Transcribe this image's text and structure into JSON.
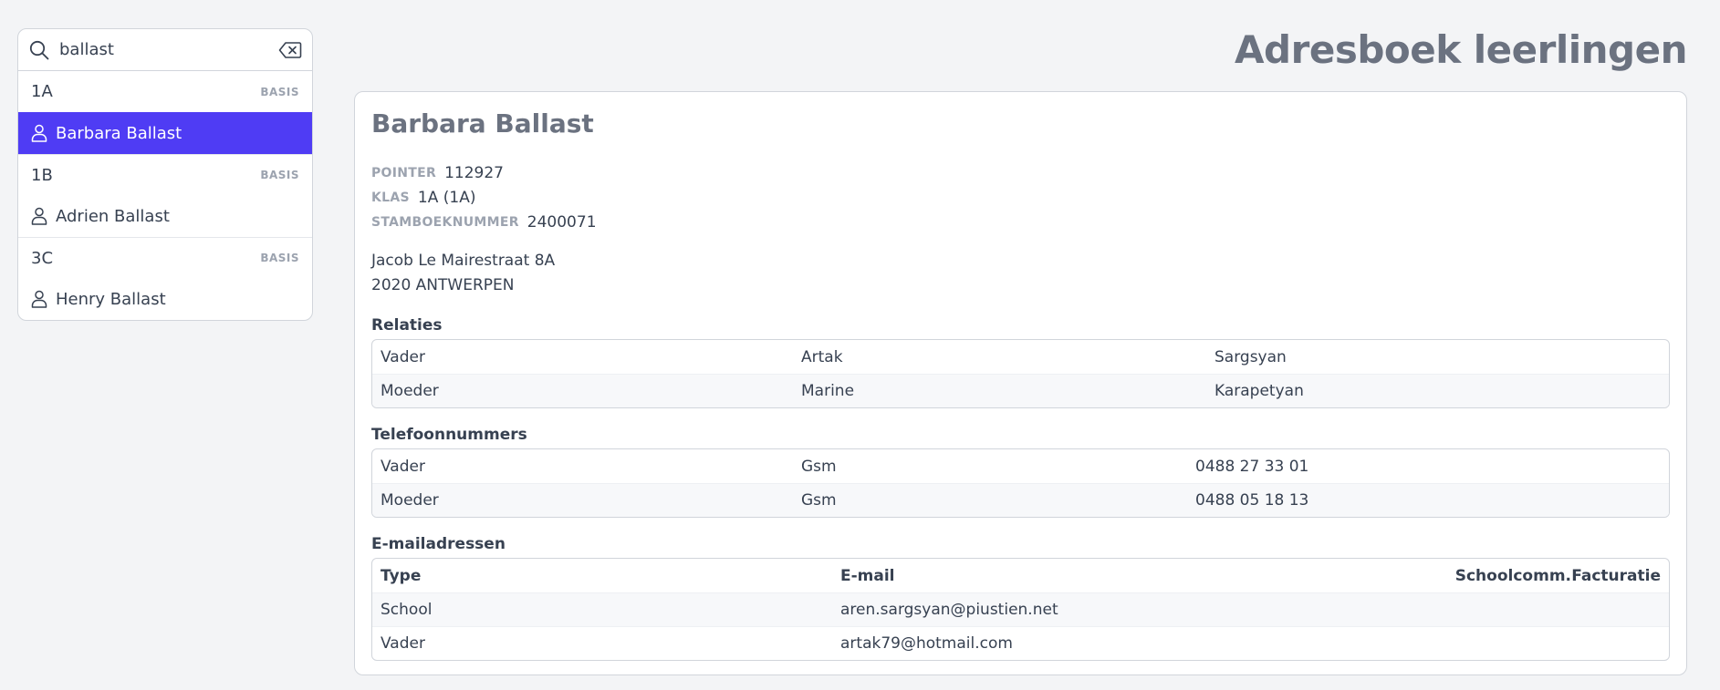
{
  "search": {
    "value": "ballast",
    "placeholder": ""
  },
  "results": {
    "groups": [
      {
        "name": "1A",
        "tag": "BASIS",
        "students": [
          {
            "name": "Barbara Ballast"
          }
        ]
      },
      {
        "name": "1B",
        "tag": "BASIS",
        "students": [
          {
            "name": "Adrien Ballast"
          }
        ]
      },
      {
        "name": "3C",
        "tag": "BASIS",
        "students": [
          {
            "name": "Henry Ballast"
          }
        ]
      }
    ]
  },
  "page": {
    "title": "Adresboek leerlingen"
  },
  "student": {
    "name": "Barbara Ballast",
    "meta": {
      "pointer_label": "POINTER",
      "pointer_value": "112927",
      "klas_label": "KLAS",
      "klas_value": "1A (1A)",
      "stamboek_label": "STAMBOEKNUMMER",
      "stamboek_value": "2400071"
    },
    "address": {
      "line1": "Jacob Le Mairestraat 8A",
      "line2": "2020 ANTWERPEN"
    }
  },
  "relaties": {
    "title": "Relaties",
    "rows": [
      {
        "relation": "Vader",
        "first": "Artak",
        "last": "Sargsyan"
      },
      {
        "relation": "Moeder",
        "first": "Marine",
        "last": "Karapetyan"
      }
    ]
  },
  "telefoon": {
    "title": "Telefoonnummers",
    "rows": [
      {
        "relation": "Vader",
        "type": "Gsm",
        "number": "0488 27 33 01"
      },
      {
        "relation": "Moeder",
        "type": "Gsm",
        "number": "0488 05 18 13"
      }
    ]
  },
  "email": {
    "title": "E-mailadressen",
    "headers": {
      "type": "Type",
      "email": "E-mail",
      "schoolcomm": "Schoolcomm.",
      "facturatie": "Facturatie"
    },
    "rows": [
      {
        "type": "School",
        "email": "aren.sargsyan@piustien.net"
      },
      {
        "type": "Vader",
        "email": "artak79@hotmail.com"
      }
    ]
  },
  "colors": {
    "accent": "#4f3cf4",
    "background": "#f3f4f6",
    "card": "#ffffff",
    "muted": "#9ca3af",
    "title": "#6b7280"
  },
  "icons": {
    "search": "search-icon",
    "clear": "backspace-icon",
    "student": "user-icon"
  }
}
